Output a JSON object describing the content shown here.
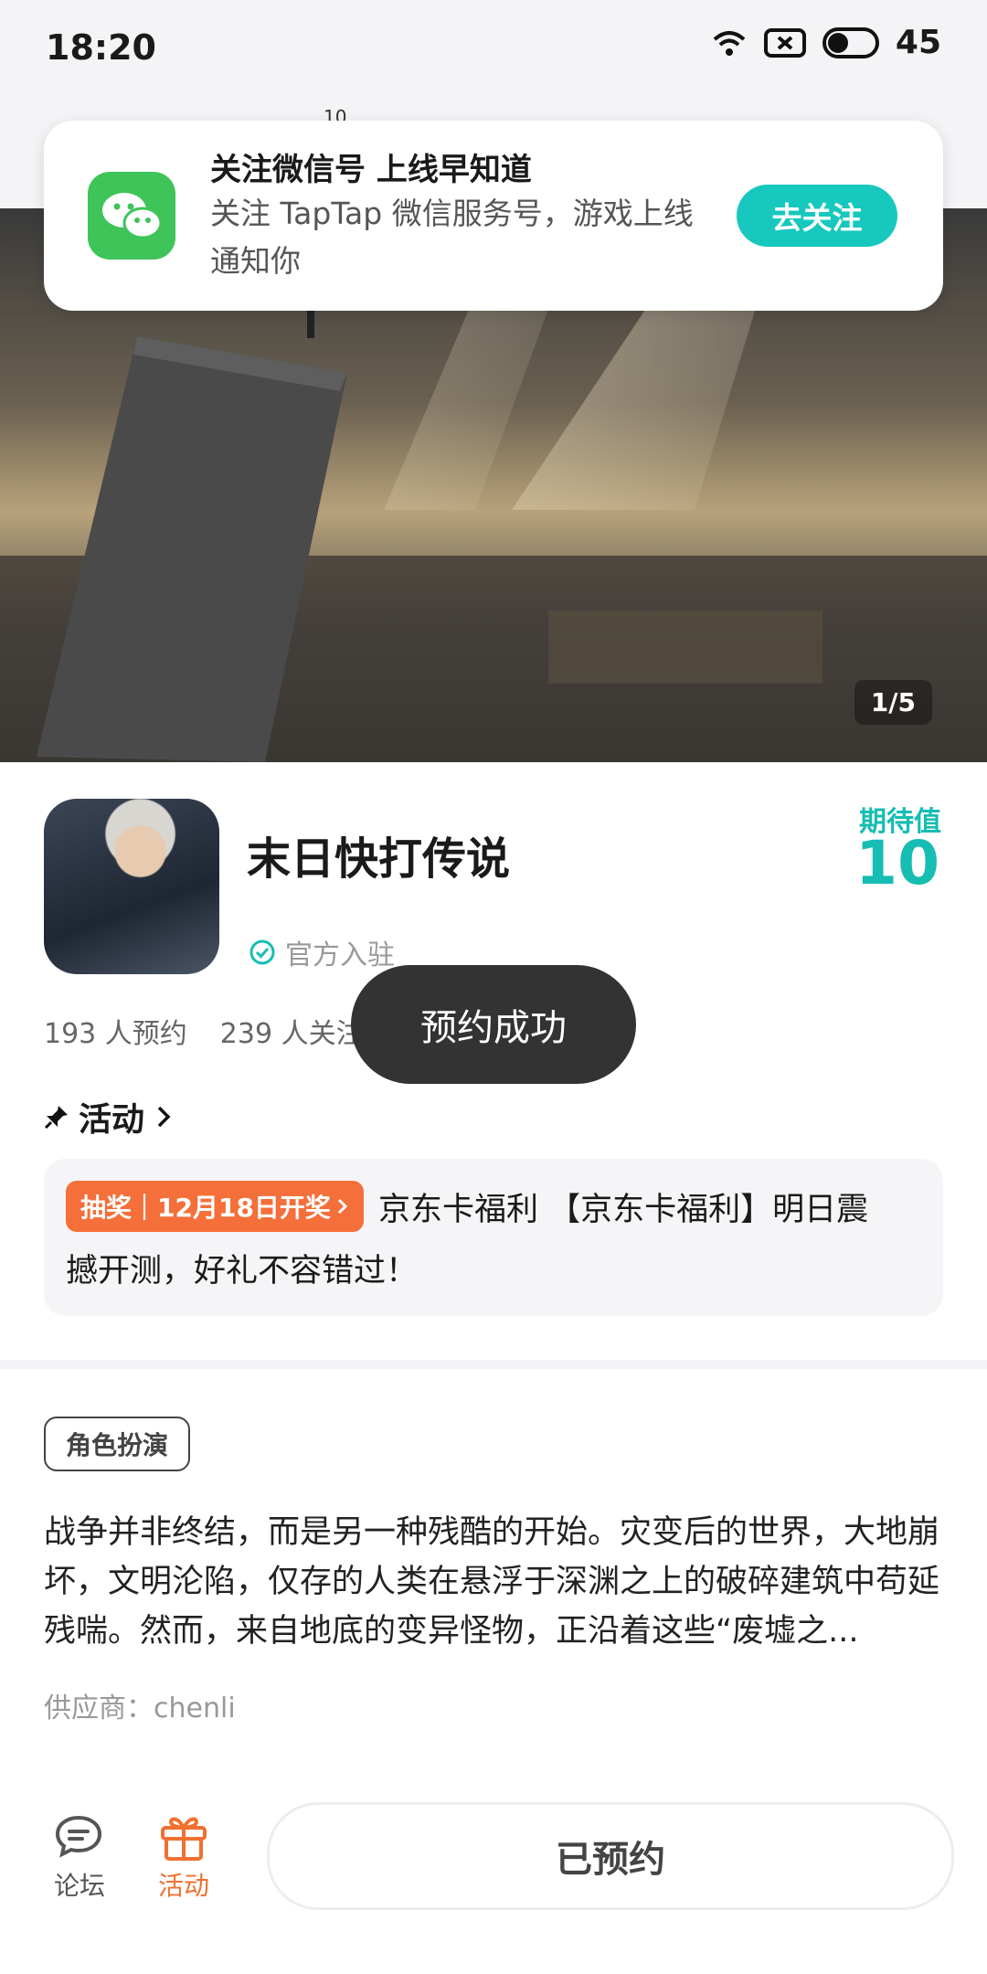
{
  "status_bar": {
    "time": "18:20",
    "battery": "45"
  },
  "header": {
    "badge_count": "10"
  },
  "wechat_banner": {
    "title": "关注微信号 上线早知道",
    "description": "关注 TapTap 微信服务号，游戏上线通知你",
    "button_label": "去关注"
  },
  "hero": {
    "counter": "1/5"
  },
  "game": {
    "title": "末日快打传说",
    "verified_label": "官方入驻",
    "expect_label": "期待值",
    "expect_value": "10",
    "reservations": "193 人预约",
    "followers": "239 人关注"
  },
  "toast": {
    "message": "预约成功"
  },
  "activity": {
    "section_label": "活动",
    "badge_label": "抽奖｜12月18日开奖",
    "title_line1": "京东卡福利 【京东卡福利】明日震",
    "title_line2": "撼开测，好礼不容错过！"
  },
  "details": {
    "genre": "角色扮演",
    "description": "战争并非终结，而是另一种残酷的开始。灾变后的世界，大地崩坏，文明沦陷，仅存的人类在悬浮于深渊之上的破碎建筑中苟延残喘。然而，来自地底的变异怪物，正沿着这些“废墟之...",
    "supplier": "供应商：chenli"
  },
  "bottom_bar": {
    "forum_label": "论坛",
    "activity_label": "活动",
    "reserved_label": "已预约"
  },
  "colors": {
    "accent": "#16c8bd",
    "activity_orange": "#f46f3a",
    "wechat_green": "#3ec458"
  }
}
